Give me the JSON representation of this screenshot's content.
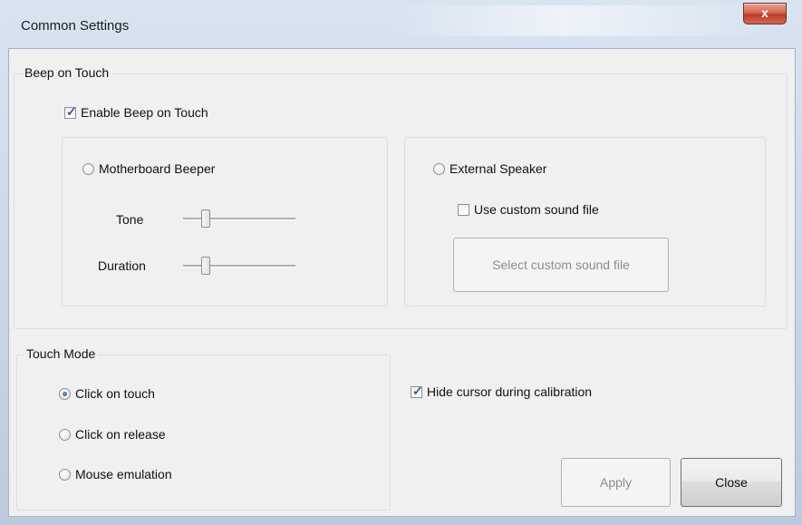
{
  "window": {
    "title": "Common Settings",
    "close_glyph": "x"
  },
  "beep_group": {
    "title": "Beep on Touch",
    "enable_label": "Enable Beep on Touch",
    "enable_checked": true,
    "motherboard": {
      "label": "Motherboard Beeper",
      "selected": false,
      "tone_label": "Tone",
      "duration_label": "Duration"
    },
    "external": {
      "label": "External Speaker",
      "selected": false,
      "custom_label": "Use custom sound file",
      "custom_checked": false,
      "select_button": "Select custom sound file"
    }
  },
  "touch_mode": {
    "title": "Touch Mode",
    "options": [
      {
        "label": "Click on touch",
        "selected": true
      },
      {
        "label": "Click on release",
        "selected": false
      },
      {
        "label": "Mouse emulation",
        "selected": false
      }
    ]
  },
  "hide_cursor": {
    "label": "Hide cursor during calibration",
    "checked": true
  },
  "buttons": {
    "apply": "Apply",
    "close": "Close"
  }
}
